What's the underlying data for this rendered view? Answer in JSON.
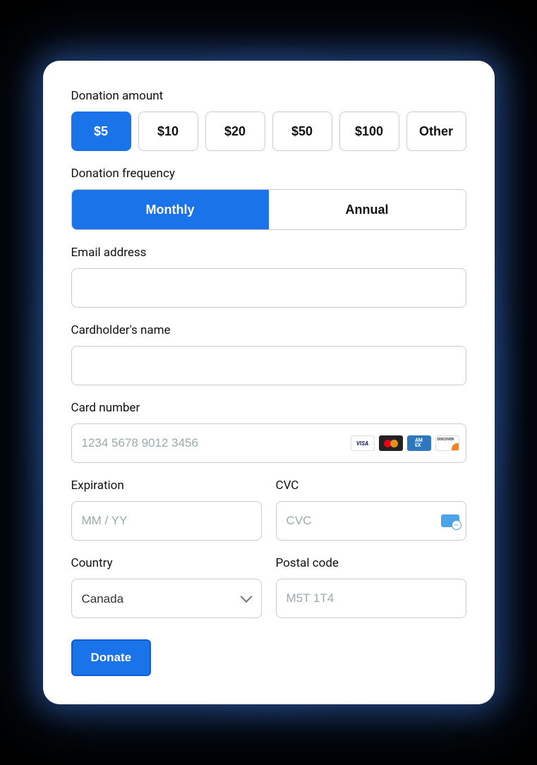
{
  "donation_amount": {
    "label": "Donation amount",
    "options": [
      "$5",
      "$10",
      "$20",
      "$50",
      "$100",
      "Other"
    ],
    "selected": "$5"
  },
  "donation_frequency": {
    "label": "Donation frequency",
    "options": [
      "Monthly",
      "Annual"
    ],
    "selected": "Monthly"
  },
  "email": {
    "label": "Email address",
    "value": "",
    "placeholder": ""
  },
  "cardholder": {
    "label": "Cardholder's name",
    "value": "",
    "placeholder": ""
  },
  "card_number": {
    "label": "Card number",
    "value": "",
    "placeholder": "1234 5678 9012 3456",
    "brands": [
      "visa",
      "mastercard",
      "amex",
      "discover"
    ]
  },
  "expiration": {
    "label": "Expiration",
    "value": "",
    "placeholder": "MM / YY"
  },
  "cvc": {
    "label": "CVC",
    "value": "",
    "placeholder": "CVC"
  },
  "country": {
    "label": "Country",
    "value": "Canada"
  },
  "postal": {
    "label": "Postal code",
    "value": "",
    "placeholder": "M5T 1T4"
  },
  "submit": {
    "label": "Donate"
  }
}
